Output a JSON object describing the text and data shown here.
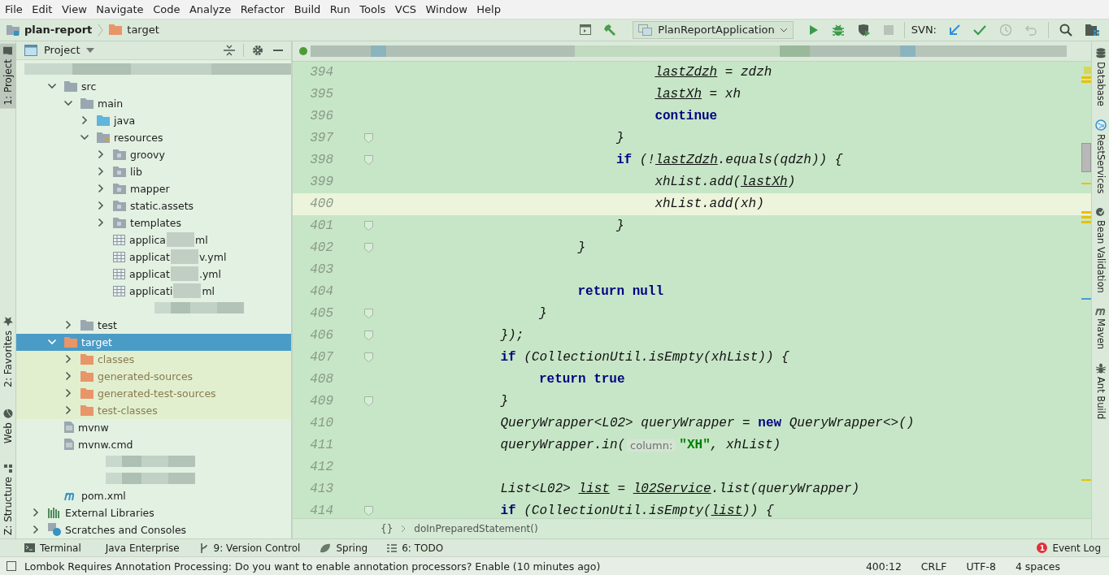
{
  "menu": [
    "File",
    "Edit",
    "View",
    "Navigate",
    "Code",
    "Analyze",
    "Refactor",
    "Build",
    "Run",
    "Tools",
    "VCS",
    "Window",
    "Help"
  ],
  "navbar": {
    "crumbs": [
      {
        "label": "plan-report",
        "kind": "module"
      },
      {
        "label": "target",
        "kind": "excluded-folder"
      }
    ],
    "run_config": "PlanReportApplication",
    "vcs_label": "SVN:"
  },
  "left_tool_tabs": [
    {
      "label": "1: Project",
      "kind": "project",
      "selected": true
    },
    {
      "label": "2: Favorites",
      "kind": "favorites",
      "selected": false
    },
    {
      "label": "Web",
      "kind": "web",
      "selected": false
    },
    {
      "label": "Z: Structure",
      "kind": "structure",
      "selected": false
    }
  ],
  "project_panel": {
    "title": "Project",
    "tree": [
      {
        "kind": "redacted",
        "expanded": true,
        "selected": false,
        "children": [
          {
            "label": "src",
            "kind": "folder",
            "expanded": true,
            "selected": false,
            "children": [
              {
                "label": "main",
                "kind": "folder",
                "expanded": true,
                "selected": false,
                "children": [
                  {
                    "label": "java",
                    "kind": "source-folder",
                    "expanded": false,
                    "selected": false
                  },
                  {
                    "label": "resources",
                    "kind": "resource-folder",
                    "expanded": true,
                    "selected": false,
                    "children": [
                      {
                        "label": "groovy",
                        "kind": "package-folder",
                        "expanded": false,
                        "selected": false
                      },
                      {
                        "label": "lib",
                        "kind": "package-folder",
                        "expanded": false,
                        "selected": false
                      },
                      {
                        "label": "mapper",
                        "kind": "package-folder",
                        "expanded": false,
                        "selected": false
                      },
                      {
                        "label": "static.assets",
                        "kind": "package-folder",
                        "expanded": false,
                        "selected": false
                      },
                      {
                        "label": "templates",
                        "kind": "package-folder",
                        "expanded": false,
                        "selected": false
                      },
                      {
                        "label": "applica",
                        "label_tail": "ml",
                        "kind": "yml",
                        "selected": false
                      },
                      {
                        "label": "applicat",
                        "label_tail": "v.yml",
                        "kind": "yml",
                        "selected": false
                      },
                      {
                        "label": "applicat",
                        "label_tail": ".yml",
                        "kind": "yml",
                        "selected": false
                      },
                      {
                        "label": "applicati",
                        "label_tail": "ml",
                        "kind": "yml",
                        "selected": false
                      },
                      {
                        "kind": "redacted",
                        "selected": false
                      }
                    ]
                  }
                ]
              },
              {
                "label": "test",
                "kind": "folder",
                "expanded": false,
                "selected": false
              }
            ]
          },
          {
            "label": "target",
            "kind": "excluded-folder",
            "expanded": true,
            "selected": true,
            "children": [
              {
                "label": "classes",
                "kind": "excluded-folder",
                "expanded": false,
                "selected": false
              },
              {
                "label": "generated-sources",
                "kind": "excluded-folder",
                "expanded": false,
                "selected": false
              },
              {
                "label": "generated-test-sources",
                "kind": "excluded-folder",
                "expanded": false,
                "selected": false
              },
              {
                "label": "test-classes",
                "kind": "excluded-folder",
                "expanded": false,
                "selected": false
              }
            ]
          },
          {
            "label": "mvnw",
            "kind": "file",
            "selected": false
          },
          {
            "label": "mvnw.cmd",
            "kind": "file",
            "selected": false
          },
          {
            "kind": "redacted",
            "selected": false
          },
          {
            "kind": "redacted",
            "selected": false
          },
          {
            "label": "pom.xml",
            "kind": "maven",
            "selected": false
          }
        ]
      },
      {
        "label": "External Libraries",
        "kind": "libraries",
        "expanded": false,
        "selected": false
      },
      {
        "label": "Scratches and Consoles",
        "kind": "scratches",
        "expanded": false,
        "selected": false
      }
    ]
  },
  "editor": {
    "lines": [
      {
        "number": "394",
        "current": false,
        "fold": false,
        "tokens": [
          {
            "text": "                            lastZdzh",
            "kind": "var"
          },
          {
            "text": " = zdzh",
            "kind": "txt"
          }
        ]
      },
      {
        "number": "395",
        "current": false,
        "fold": false,
        "tokens": [
          {
            "text": "                            lastXh",
            "kind": "var"
          },
          {
            "text": " = xh",
            "kind": "txt"
          }
        ]
      },
      {
        "number": "396",
        "current": false,
        "fold": false,
        "tokens": [
          {
            "text": "                            continue",
            "kind": "kw"
          }
        ]
      },
      {
        "number": "397",
        "current": false,
        "fold": true,
        "tokens": [
          {
            "text": "                        }",
            "kind": "txt"
          }
        ]
      },
      {
        "number": "398",
        "current": false,
        "fold": true,
        "tokens": [
          {
            "text": "                        if",
            "kind": "kw"
          },
          {
            "text": " (!",
            "kind": "txt"
          },
          {
            "text": "lastZdzh",
            "kind": "var"
          },
          {
            "text": ".equals(qdzh)) {",
            "kind": "txt"
          }
        ]
      },
      {
        "number": "399",
        "current": false,
        "fold": false,
        "tokens": [
          {
            "text": "                            xhList.add(",
            "kind": "txt"
          },
          {
            "text": "lastXh",
            "kind": "var"
          },
          {
            "text": ")",
            "kind": "txt"
          }
        ]
      },
      {
        "number": "400",
        "current": true,
        "fold": false,
        "tokens": [
          {
            "text": "                            xhList.add(xh)",
            "kind": "txt"
          }
        ]
      },
      {
        "number": "401",
        "current": false,
        "fold": true,
        "tokens": [
          {
            "text": "                        }",
            "kind": "txt"
          }
        ]
      },
      {
        "number": "402",
        "current": false,
        "fold": true,
        "tokens": [
          {
            "text": "                    }",
            "kind": "txt"
          }
        ]
      },
      {
        "number": "403",
        "current": false,
        "fold": false
      },
      {
        "number": "404",
        "current": false,
        "fold": false,
        "tokens": [
          {
            "text": "                    return null",
            "kind": "kw"
          }
        ]
      },
      {
        "number": "405",
        "current": false,
        "fold": true,
        "tokens": [
          {
            "text": "                }",
            "kind": "txt"
          }
        ]
      },
      {
        "number": "406",
        "current": false,
        "fold": true,
        "tokens": [
          {
            "text": "            });",
            "kind": "txt"
          }
        ]
      },
      {
        "number": "407",
        "current": false,
        "fold": true,
        "tokens": [
          {
            "text": "            if",
            "kind": "kw"
          },
          {
            "text": " (CollectionUtil.isEmpty(xhList)) {",
            "kind": "txt"
          }
        ]
      },
      {
        "number": "408",
        "current": false,
        "fold": false,
        "tokens": [
          {
            "text": "                return true",
            "kind": "kw"
          }
        ]
      },
      {
        "number": "409",
        "current": false,
        "fold": true,
        "tokens": [
          {
            "text": "            }",
            "kind": "txt"
          }
        ]
      },
      {
        "number": "410",
        "current": false,
        "fold": false,
        "tokens": [
          {
            "text": "            QueryWrapper<L02> queryWrapper = ",
            "kind": "txt"
          },
          {
            "text": "new",
            "kind": "kw"
          },
          {
            "text": " QueryWrapper<>()",
            "kind": "txt"
          }
        ]
      },
      {
        "number": "411",
        "current": false,
        "fold": false,
        "tokens": [
          {
            "text": "            queryWrapper.in(",
            "kind": "txt"
          },
          {
            "text": "column:",
            "kind": "hint"
          },
          {
            "text": "\"XH\"",
            "kind": "str"
          },
          {
            "text": ", xhList)",
            "kind": "txt"
          }
        ]
      },
      {
        "number": "412",
        "current": false,
        "fold": false
      },
      {
        "number": "413",
        "current": false,
        "fold": false,
        "tokens": [
          {
            "text": "            List<L02> ",
            "kind": "txt"
          },
          {
            "text": "list",
            "kind": "var"
          },
          {
            "text": " = ",
            "kind": "txt"
          },
          {
            "text": "l02Service",
            "kind": "var"
          },
          {
            "text": ".list(queryWrapper)",
            "kind": "txt"
          }
        ]
      },
      {
        "number": "414",
        "current": false,
        "fold": true,
        "tokens": [
          {
            "text": "            if",
            "kind": "kw"
          },
          {
            "text": " (CollectionUtil.isEmpty(",
            "kind": "txt"
          },
          {
            "text": "list",
            "kind": "var"
          },
          {
            "text": ")) {",
            "kind": "txt"
          }
        ]
      }
    ],
    "breadcrumb_icon": "{}",
    "breadcrumb": "doInPreparedStatement()"
  },
  "right_tool_tabs": [
    {
      "label": "Database",
      "kind": "database"
    },
    {
      "label": "RestServices",
      "kind": "rest"
    },
    {
      "label": "Bean Validation",
      "kind": "bean"
    },
    {
      "label": "Maven",
      "kind": "maven"
    },
    {
      "label": "Ant Build",
      "kind": "ant"
    }
  ],
  "bottom_tool_tabs": [
    {
      "label": "Terminal",
      "kind": "terminal"
    },
    {
      "label": "Java Enterprise",
      "kind": "javaee"
    },
    {
      "label": "9: Version Control",
      "kind": "vcs"
    },
    {
      "label": "Spring",
      "kind": "spring"
    },
    {
      "label": "6: TODO",
      "kind": "todo"
    }
  ],
  "event_log": {
    "label": "Event Log",
    "badge": "1"
  },
  "status_bar": {
    "message": "Lombok Requires Annotation Processing: Do you want to enable annotation processors? Enable (10 minutes ago)",
    "position": "400:12",
    "line_separator": "CRLF",
    "encoding": "UTF-8",
    "indent": "4 spaces"
  }
}
